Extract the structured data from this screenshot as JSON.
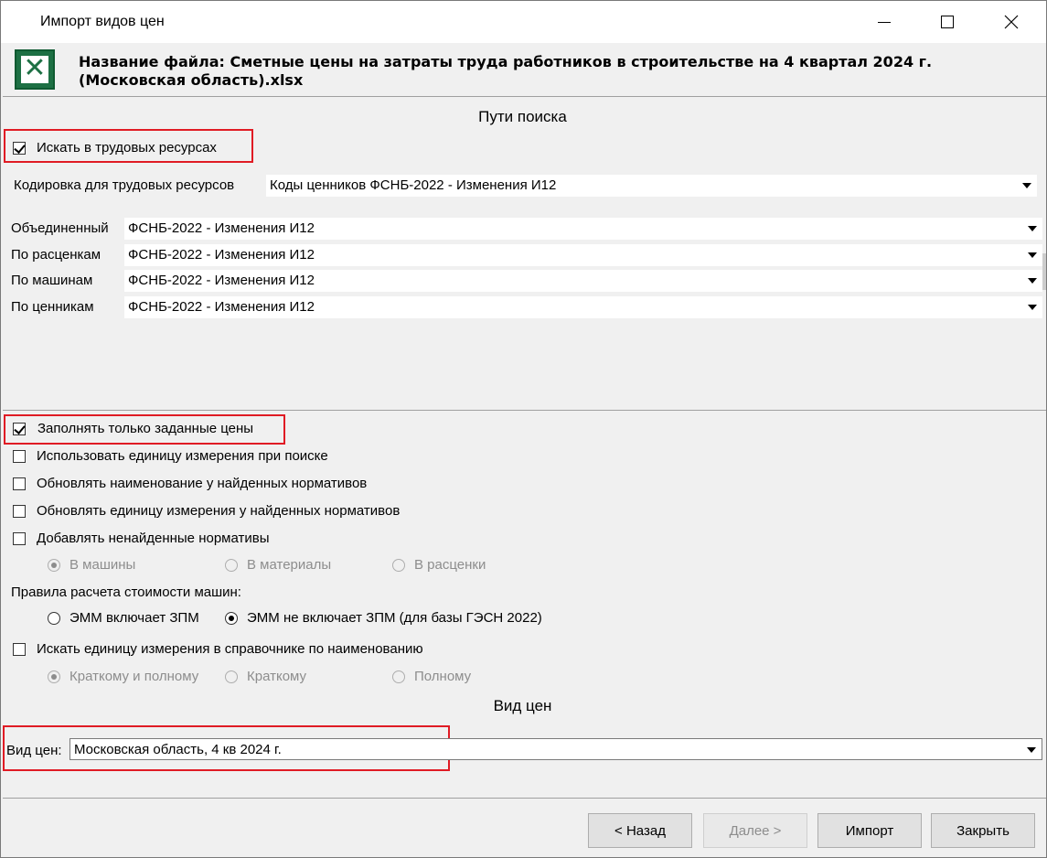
{
  "window": {
    "title": "Импорт видов цен"
  },
  "file": {
    "label": "Название файла: Сметные цены на затраты труда работников в строительстве на 4 квартал 2024 г. (Московская область).xlsx"
  },
  "search": {
    "section_title": "Пути поиска",
    "search_in_labor": {
      "label": "Искать в трудовых ресурсах",
      "checked": true
    },
    "labor_encoding": {
      "label": "Кодировка для трудовых ресурсов",
      "value": "Коды ценников ФСНБ-2022 - Изменения И12"
    },
    "rows": [
      {
        "label": "Объединенный",
        "value": "ФСНБ-2022 - Изменения И12"
      },
      {
        "label": "По расценкам",
        "value": "ФСНБ-2022 - Изменения И12"
      },
      {
        "label": "По машинам",
        "value": "ФСНБ-2022 - Изменения И12"
      },
      {
        "label": "По ценникам",
        "value": "ФСНБ-2022 - Изменения И12"
      }
    ]
  },
  "options": {
    "fill_only": {
      "label": "Заполнять только заданные цены",
      "checked": true
    },
    "use_unit": {
      "label": "Использовать единицу измерения при поиске",
      "checked": false
    },
    "update_name": {
      "label": "Обновлять наименование у найденных нормативов",
      "checked": false
    },
    "update_unit": {
      "label": "Обновлять единицу измерения у найденных нормативов",
      "checked": false
    },
    "add_missing": {
      "label": "Добавлять ненайденные нормативы",
      "checked": false
    },
    "add_target": [
      "В машины",
      "В материалы",
      "В расценки"
    ],
    "machine_rules_label": "Правила расчета стоимости машин:",
    "machine_rules": [
      "ЭММ включает ЗПМ",
      "ЭММ не включает ЗПМ (для базы ГЭСН 2022)"
    ],
    "search_unit_ref": {
      "label": "Искать единицу измерения в справочнике по наименованию",
      "checked": false
    },
    "unit_ref_modes": [
      "Краткому и полному",
      "Краткому",
      "Полному"
    ]
  },
  "price_type": {
    "section_title": "Вид цен",
    "label": "Вид цен:",
    "value": "Московская область, 4 кв 2024 г."
  },
  "buttons": {
    "back": "< Назад",
    "next": "Далее >",
    "import": "Импорт",
    "close": "Закрыть"
  },
  "colors": {
    "highlight": "#e01b24",
    "excel": "#1d7044"
  }
}
